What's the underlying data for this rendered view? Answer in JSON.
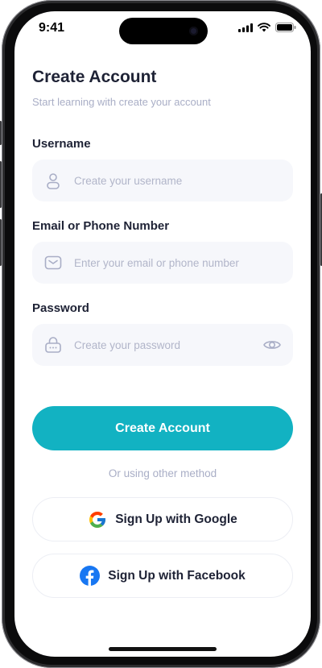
{
  "status_bar": {
    "time": "9:41",
    "icons": [
      "signal-icon",
      "wifi-icon",
      "battery-icon"
    ]
  },
  "header": {
    "title": "Create Account",
    "subtitle": "Start learning with create your account"
  },
  "form": {
    "username": {
      "label": "Username",
      "placeholder": "Create your username",
      "value": "",
      "icon": "user-icon"
    },
    "email": {
      "label": "Email or Phone Number",
      "placeholder": "Enter your email or phone number",
      "value": "",
      "icon": "mail-icon"
    },
    "password": {
      "label": "Password",
      "placeholder": "Create your password",
      "value": "",
      "icon": "lock-icon",
      "toggle_icon": "eye-icon"
    }
  },
  "actions": {
    "create_account_label": "Create Account",
    "divider_text": "Or using other method",
    "google_label": "Sign Up with Google",
    "facebook_label": "Sign Up with Facebook"
  },
  "colors": {
    "primary": "#12b2c2",
    "title_text": "#1e2235",
    "muted_text": "#a9aec6",
    "field_bg": "#f6f7fb",
    "facebook_blue": "#1877f2"
  }
}
